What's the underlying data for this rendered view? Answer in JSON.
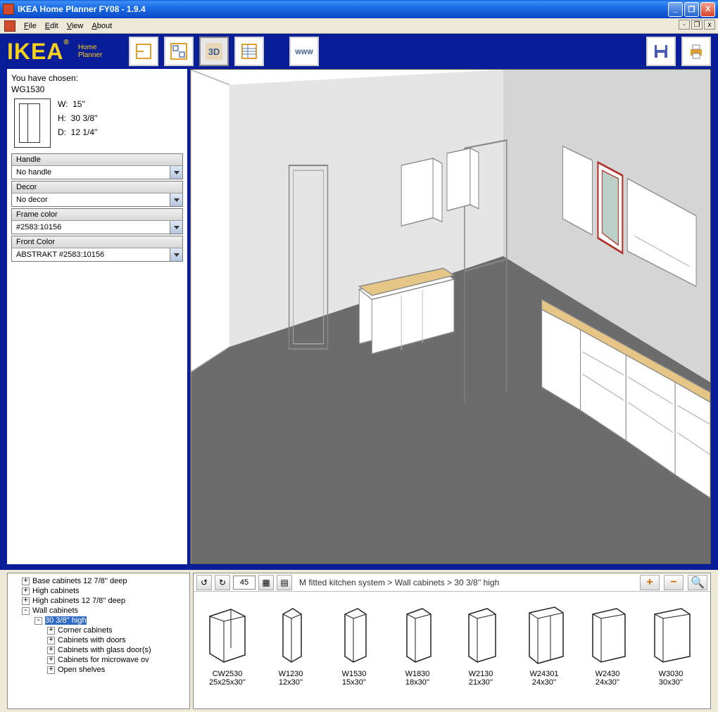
{
  "title": "IKEA Home Planner FY08  - 1.9.4",
  "menu": {
    "file": "File",
    "edit": "Edit",
    "view": "View",
    "about": "About"
  },
  "logo": {
    "text": "IKEA",
    "caption1": "Home",
    "caption2": "Planner"
  },
  "toolbar": {
    "label_3d": "3D",
    "label_www": "WWW"
  },
  "chosen": {
    "label": "You have chosen:",
    "code": "WG1530",
    "w_label": "W:",
    "w_val": "15''",
    "h_label": "H:",
    "h_val": "30 3/8''",
    "d_label": "D:",
    "d_val": "12 1/4''"
  },
  "dropdowns": {
    "handle": {
      "label": "Handle",
      "value": "No handle"
    },
    "decor": {
      "label": "Decor",
      "value": "No decor"
    },
    "frame": {
      "label": "Frame color",
      "value": "#2583:10156"
    },
    "front": {
      "label": "Front Color",
      "value": "ABSTRAKT #2583:10156"
    }
  },
  "tree": {
    "i0": "Base cabinets 12 7/8'' deep",
    "i1": "High cabinets",
    "i2": "High cabinets 12 7/8'' deep",
    "i3": "Wall cabinets",
    "i4": "30 3/8'' high",
    "i5": "Corner cabinets",
    "i6": "Cabinets with doors",
    "i7": "Cabinets with glass door(s)",
    "i8": "Cabinets for microwave ov",
    "i9": "Open shelves"
  },
  "catalog": {
    "angle": "45",
    "breadcrumb": "M fitted kitchen system > Wall cabinets > 30 3/8'' high",
    "items": [
      {
        "name": "CW2530",
        "dims": "25x25x30''"
      },
      {
        "name": "W1230",
        "dims": "12x30''"
      },
      {
        "name": "W1530",
        "dims": "15x30''"
      },
      {
        "name": "W1830",
        "dims": "18x30''"
      },
      {
        "name": "W2130",
        "dims": "21x30''"
      },
      {
        "name": "W24301",
        "dims": "24x30''"
      },
      {
        "name": "W2430",
        "dims": "24x30''"
      },
      {
        "name": "W3030",
        "dims": "30x30''"
      }
    ]
  }
}
